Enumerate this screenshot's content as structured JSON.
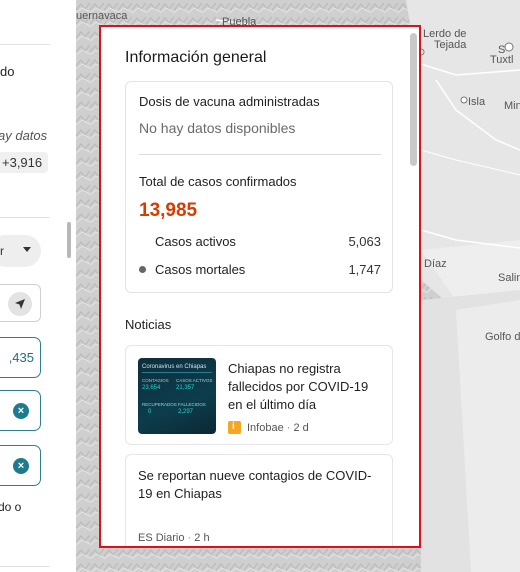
{
  "left_panel": {
    "partial_text_1": "do",
    "partial_text_2": "ay datos",
    "chip_value": "+3,916",
    "select_value": "r",
    "pill_value": ",435",
    "pill_icon_1": "close-circle-icon",
    "pill_icon_2": "close-circle-icon",
    "partial_text_3": "do o"
  },
  "map": {
    "labels": {
      "cuernavaca": "uernavaca",
      "puebla": "Puebla",
      "lerdo": "Lerdo de",
      "tejada": "Tejada",
      "tuxtla": "Tuxtl",
      "s_partial": "S",
      "isla": "Isla",
      "min": "Min",
      "diaz": "Díaz",
      "salina": "Salina",
      "golfo": "Golfo de"
    }
  },
  "card": {
    "title": "Información general",
    "vaccines": {
      "title": "Dosis de vacuna administradas",
      "no_data": "No hay datos disponibles"
    },
    "cases": {
      "title": "Total de casos confirmados",
      "total": "13,985",
      "active_label": "Casos activos",
      "active_value": "5,063",
      "deaths_label": "Casos mortales",
      "deaths_value": "1,747"
    },
    "news": {
      "title": "Noticias",
      "items": [
        {
          "headline": "Chiapas no registra fallecidos por COVID-19 en el último día",
          "source": "Infobae",
          "age": "2 d",
          "thumbnail": {
            "heading": "Coronavirus en Chiapas",
            "contagios_label": "CONTAGIOS",
            "contagios_value": "23,654",
            "activos_label": "CASOS ACTIVOS",
            "activos_value": "21,357",
            "recuperados_label": "RECUPERADOS",
            "recuperados_value": "0",
            "fallecidos_label": "FALLECIDOS",
            "fallecidos_value": "2,297"
          }
        },
        {
          "headline": "Se reportan nueve contagios de COVID-19 en Chiapas",
          "source": "ES Diario",
          "age": "2 h"
        }
      ]
    }
  },
  "colors": {
    "highlight_border": "#e0101a",
    "cases_total": "#d83b01",
    "accent_teal": "#1f7a8c"
  }
}
